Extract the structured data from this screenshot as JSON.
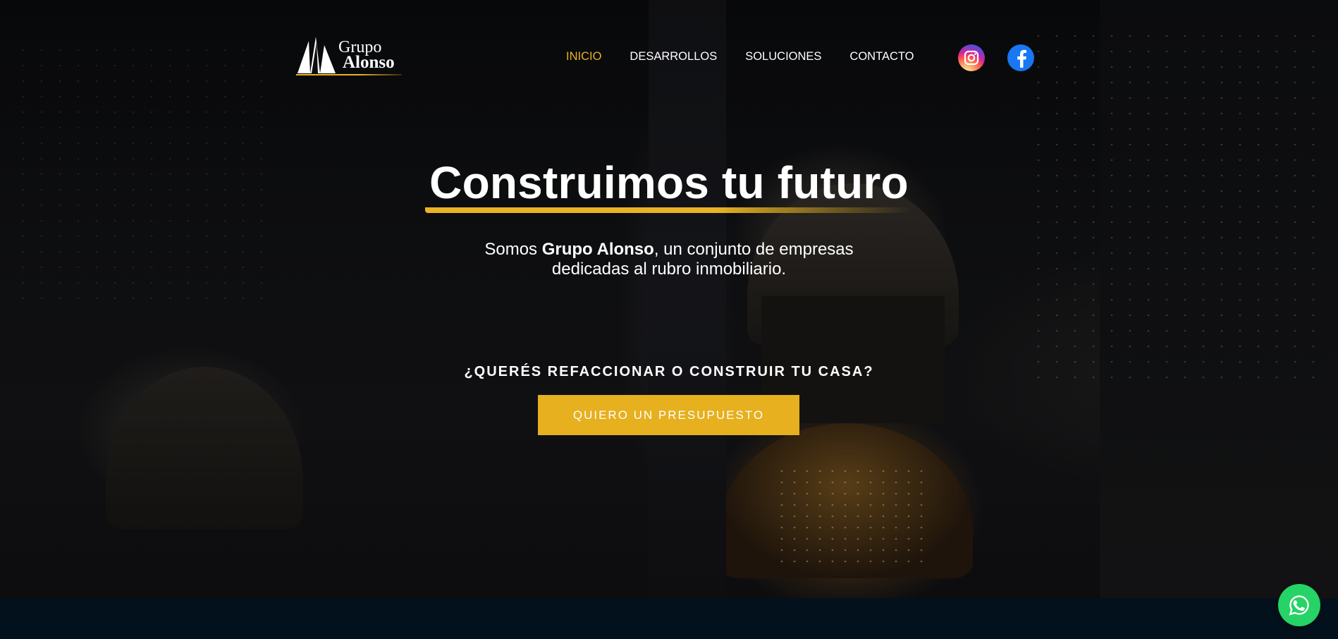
{
  "brand": {
    "name_line1": "Grupo",
    "name_line2": "Alonso",
    "accent_color": "#e9b324",
    "bottom_band_color": "#03111d"
  },
  "nav": {
    "items": [
      {
        "label": "INICIO",
        "active": true
      },
      {
        "label": "DESARROLLOS",
        "active": false
      },
      {
        "label": "SOLUCIONES",
        "active": false
      },
      {
        "label": "CONTACTO",
        "active": false
      }
    ]
  },
  "social": {
    "icons": [
      "instagram-icon",
      "facebook-icon"
    ]
  },
  "hero": {
    "headline": "Construimos tu futuro",
    "intro_prefix": "Somos ",
    "intro_brand": "Grupo Alonso",
    "intro_suffix": ", un conjunto de empresas",
    "intro_line2": "dedicadas al rubro inmobiliario.",
    "cta_question": "¿QUERÉS REFACCIONAR O CONSTRUIR TU CASA?",
    "cta_button": "QUIERO UN PRESUPUESTO"
  },
  "floating": {
    "whatsapp_icon": "whatsapp-icon",
    "whatsapp_color": "#25d366"
  }
}
